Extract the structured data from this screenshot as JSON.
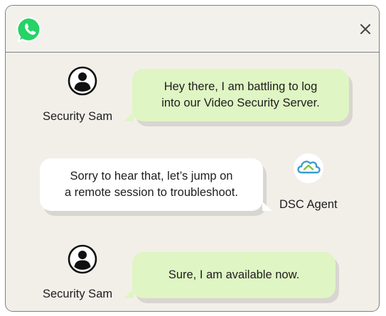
{
  "header": {
    "app_icon": "whatsapp-icon",
    "close_icon": "close-icon",
    "close_label": "×"
  },
  "messages": [
    {
      "sender": "Security Sam",
      "text_line1": "Hey there, I am battling to log",
      "text_line2": "into our Video Security Server.",
      "icon": "user-avatar-icon"
    },
    {
      "sender": "DSC Agent",
      "text_line1": "Sorry to hear that, let’s jump on",
      "text_line2": "a remote session to troubleshoot.",
      "icon": "dsc-agent-logo-icon"
    },
    {
      "sender": "Security Sam",
      "text_line1": "Sure, I am available now.",
      "icon": "user-avatar-icon"
    }
  ],
  "colors": {
    "incoming_bubble": "#dff5c3",
    "outgoing_bubble": "#ffffff",
    "chat_background": "#f2efe9",
    "whatsapp_green": "#25d366"
  }
}
